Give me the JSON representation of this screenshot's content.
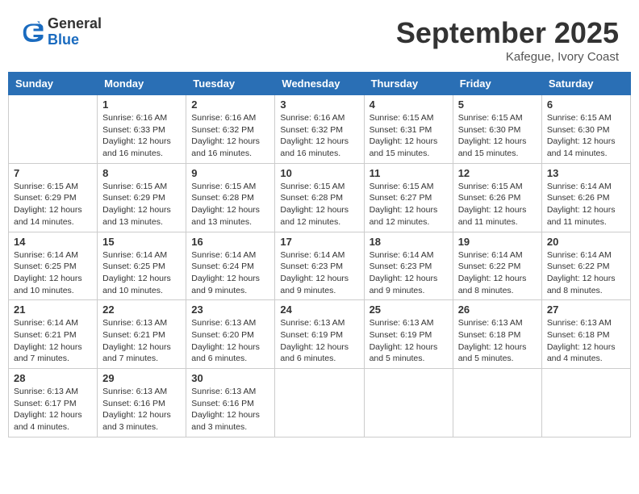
{
  "header": {
    "logo_general": "General",
    "logo_blue": "Blue",
    "month_title": "September 2025",
    "location": "Kafegue, Ivory Coast"
  },
  "days_of_week": [
    "Sunday",
    "Monday",
    "Tuesday",
    "Wednesday",
    "Thursday",
    "Friday",
    "Saturday"
  ],
  "weeks": [
    [
      {
        "day": "",
        "info": ""
      },
      {
        "day": "1",
        "info": "Sunrise: 6:16 AM\nSunset: 6:33 PM\nDaylight: 12 hours\nand 16 minutes."
      },
      {
        "day": "2",
        "info": "Sunrise: 6:16 AM\nSunset: 6:32 PM\nDaylight: 12 hours\nand 16 minutes."
      },
      {
        "day": "3",
        "info": "Sunrise: 6:16 AM\nSunset: 6:32 PM\nDaylight: 12 hours\nand 16 minutes."
      },
      {
        "day": "4",
        "info": "Sunrise: 6:15 AM\nSunset: 6:31 PM\nDaylight: 12 hours\nand 15 minutes."
      },
      {
        "day": "5",
        "info": "Sunrise: 6:15 AM\nSunset: 6:30 PM\nDaylight: 12 hours\nand 15 minutes."
      },
      {
        "day": "6",
        "info": "Sunrise: 6:15 AM\nSunset: 6:30 PM\nDaylight: 12 hours\nand 14 minutes."
      }
    ],
    [
      {
        "day": "7",
        "info": "Sunrise: 6:15 AM\nSunset: 6:29 PM\nDaylight: 12 hours\nand 14 minutes."
      },
      {
        "day": "8",
        "info": "Sunrise: 6:15 AM\nSunset: 6:29 PM\nDaylight: 12 hours\nand 13 minutes."
      },
      {
        "day": "9",
        "info": "Sunrise: 6:15 AM\nSunset: 6:28 PM\nDaylight: 12 hours\nand 13 minutes."
      },
      {
        "day": "10",
        "info": "Sunrise: 6:15 AM\nSunset: 6:28 PM\nDaylight: 12 hours\nand 12 minutes."
      },
      {
        "day": "11",
        "info": "Sunrise: 6:15 AM\nSunset: 6:27 PM\nDaylight: 12 hours\nand 12 minutes."
      },
      {
        "day": "12",
        "info": "Sunrise: 6:15 AM\nSunset: 6:26 PM\nDaylight: 12 hours\nand 11 minutes."
      },
      {
        "day": "13",
        "info": "Sunrise: 6:14 AM\nSunset: 6:26 PM\nDaylight: 12 hours\nand 11 minutes."
      }
    ],
    [
      {
        "day": "14",
        "info": "Sunrise: 6:14 AM\nSunset: 6:25 PM\nDaylight: 12 hours\nand 10 minutes."
      },
      {
        "day": "15",
        "info": "Sunrise: 6:14 AM\nSunset: 6:25 PM\nDaylight: 12 hours\nand 10 minutes."
      },
      {
        "day": "16",
        "info": "Sunrise: 6:14 AM\nSunset: 6:24 PM\nDaylight: 12 hours\nand 9 minutes."
      },
      {
        "day": "17",
        "info": "Sunrise: 6:14 AM\nSunset: 6:23 PM\nDaylight: 12 hours\nand 9 minutes."
      },
      {
        "day": "18",
        "info": "Sunrise: 6:14 AM\nSunset: 6:23 PM\nDaylight: 12 hours\nand 9 minutes."
      },
      {
        "day": "19",
        "info": "Sunrise: 6:14 AM\nSunset: 6:22 PM\nDaylight: 12 hours\nand 8 minutes."
      },
      {
        "day": "20",
        "info": "Sunrise: 6:14 AM\nSunset: 6:22 PM\nDaylight: 12 hours\nand 8 minutes."
      }
    ],
    [
      {
        "day": "21",
        "info": "Sunrise: 6:14 AM\nSunset: 6:21 PM\nDaylight: 12 hours\nand 7 minutes."
      },
      {
        "day": "22",
        "info": "Sunrise: 6:13 AM\nSunset: 6:21 PM\nDaylight: 12 hours\nand 7 minutes."
      },
      {
        "day": "23",
        "info": "Sunrise: 6:13 AM\nSunset: 6:20 PM\nDaylight: 12 hours\nand 6 minutes."
      },
      {
        "day": "24",
        "info": "Sunrise: 6:13 AM\nSunset: 6:19 PM\nDaylight: 12 hours\nand 6 minutes."
      },
      {
        "day": "25",
        "info": "Sunrise: 6:13 AM\nSunset: 6:19 PM\nDaylight: 12 hours\nand 5 minutes."
      },
      {
        "day": "26",
        "info": "Sunrise: 6:13 AM\nSunset: 6:18 PM\nDaylight: 12 hours\nand 5 minutes."
      },
      {
        "day": "27",
        "info": "Sunrise: 6:13 AM\nSunset: 6:18 PM\nDaylight: 12 hours\nand 4 minutes."
      }
    ],
    [
      {
        "day": "28",
        "info": "Sunrise: 6:13 AM\nSunset: 6:17 PM\nDaylight: 12 hours\nand 4 minutes."
      },
      {
        "day": "29",
        "info": "Sunrise: 6:13 AM\nSunset: 6:16 PM\nDaylight: 12 hours\nand 3 minutes."
      },
      {
        "day": "30",
        "info": "Sunrise: 6:13 AM\nSunset: 6:16 PM\nDaylight: 12 hours\nand 3 minutes."
      },
      {
        "day": "",
        "info": ""
      },
      {
        "day": "",
        "info": ""
      },
      {
        "day": "",
        "info": ""
      },
      {
        "day": "",
        "info": ""
      }
    ]
  ]
}
